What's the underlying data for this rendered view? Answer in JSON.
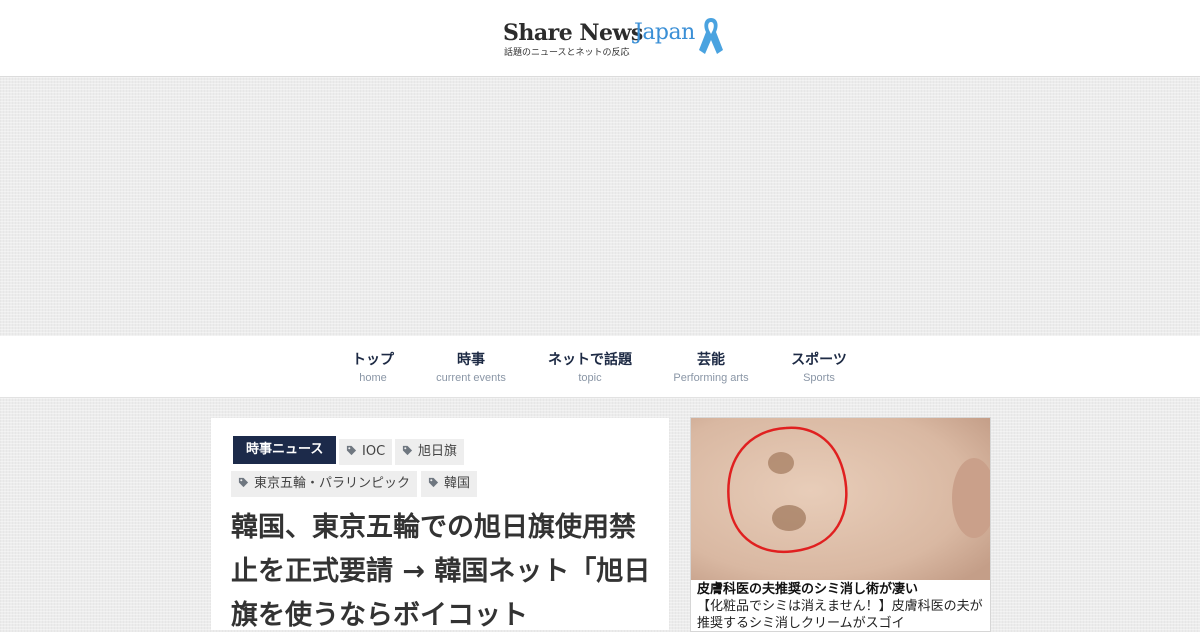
{
  "site": {
    "logo_share_news": "Share News",
    "logo_japan": "Japan",
    "tagline": "話題のニュースとネットの反応",
    "brand_blue": "#3a8fd6",
    "brand_navy": "#1c2a4a"
  },
  "nav": {
    "items": [
      {
        "label": "トップ",
        "sub": "home"
      },
      {
        "label": "時事",
        "sub": "current events"
      },
      {
        "label": "ネットで話題",
        "sub": "topic"
      },
      {
        "label": "芸能",
        "sub": "Performing arts"
      },
      {
        "label": "スポーツ",
        "sub": "Sports"
      }
    ]
  },
  "article": {
    "category": "時事ニュース",
    "tags": [
      "IOC",
      "旭日旗",
      "東京五輪・パラリンピック",
      "韓国"
    ],
    "tag_icon": "tag-icon",
    "title": "韓国、東京五輪での旭日旗使用禁止を正式要請 → 韓国ネット「旭日旗を使うならボイコット"
  },
  "sidebar": {
    "ad_headline": "皮膚科医の夫推奨のシミ消し術が凄い",
    "ad_body": "【化粧品でシミは消えません！】皮膚科医の夫が推奨するシミ消しクリームがスゴイ"
  }
}
